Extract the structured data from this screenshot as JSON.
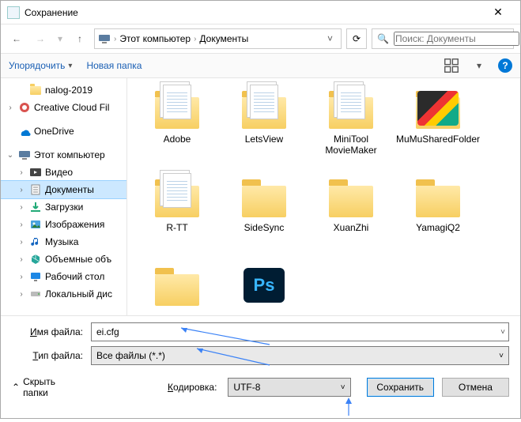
{
  "window": {
    "title": "Сохранение",
    "close_glyph": "✕"
  },
  "nav": {
    "back_glyph": "←",
    "forward_glyph": "→",
    "recent_glyph": "▾",
    "up_glyph": "↑",
    "refresh_glyph": "⟳",
    "address_dropdown_glyph": "˅"
  },
  "breadcrumb": {
    "sep": "›",
    "root": "Этот компьютер",
    "current": "Документы"
  },
  "search": {
    "placeholder": "Поиск: Документы",
    "icon_glyph": "🔍"
  },
  "cmdbar": {
    "organize": "Упорядочить",
    "organize_arrow": "▾",
    "new_folder": "Новая папка",
    "help_glyph": "?"
  },
  "tree": [
    {
      "depth": 2,
      "expander": "",
      "icon": "folder",
      "label": "nalog-2019"
    },
    {
      "depth": 1,
      "expander": "›",
      "icon": "cc",
      "label": "Creative Cloud Fil"
    },
    {
      "depth": 1,
      "expander": "",
      "icon": "onedrive",
      "label": "OneDrive"
    },
    {
      "depth": 1,
      "expander": "⌄",
      "icon": "pc",
      "label": "Этот компьютер"
    },
    {
      "depth": 2,
      "expander": "›",
      "icon": "video",
      "label": "Видео"
    },
    {
      "depth": 2,
      "expander": "›",
      "icon": "docs",
      "label": "Документы",
      "selected": true
    },
    {
      "depth": 2,
      "expander": "›",
      "icon": "down",
      "label": "Загрузки"
    },
    {
      "depth": 2,
      "expander": "›",
      "icon": "images",
      "label": "Изображения"
    },
    {
      "depth": 2,
      "expander": "›",
      "icon": "music",
      "label": "Музыка"
    },
    {
      "depth": 2,
      "expander": "›",
      "icon": "3d",
      "label": "Объемные объ"
    },
    {
      "depth": 2,
      "expander": "›",
      "icon": "desktop",
      "label": "Рабочий стол"
    },
    {
      "depth": 2,
      "expander": "›",
      "icon": "disk",
      "label": "Локальный дис"
    }
  ],
  "items": [
    {
      "kind": "docfolder",
      "label": "Adobe"
    },
    {
      "kind": "docfolder",
      "label": "LetsView"
    },
    {
      "kind": "docfolder",
      "label": "MiniTool MovieMaker"
    },
    {
      "kind": "mumu",
      "label": "MuMuSharedFolder"
    },
    {
      "kind": "docfolder",
      "label": "R-TT"
    },
    {
      "kind": "folder",
      "label": "SideSync"
    },
    {
      "kind": "folder",
      "label": "XuanZhi"
    },
    {
      "kind": "folder",
      "label": "YamagiQ2"
    },
    {
      "kind": "folder",
      "label": ""
    },
    {
      "kind": "ps",
      "label": ""
    }
  ],
  "fields": {
    "filename_label_pre": "",
    "filename_label_u": "И",
    "filename_label_post": "мя файла:",
    "filename_value": "ei.cfg",
    "filetype_label_pre": "",
    "filetype_label_u": "Т",
    "filetype_label_post": "ип файла:",
    "filetype_value": "Все файлы  (*.*)",
    "dropdown_glyph": "˅"
  },
  "footer": {
    "hide_folders": "Скрыть папки",
    "hide_arrow": "⌃",
    "encoding_label_pre": "",
    "encoding_label_u": "К",
    "encoding_label_post": "одировка:",
    "encoding_value": "UTF-8",
    "save": "Сохранить",
    "cancel": "Отмена"
  }
}
